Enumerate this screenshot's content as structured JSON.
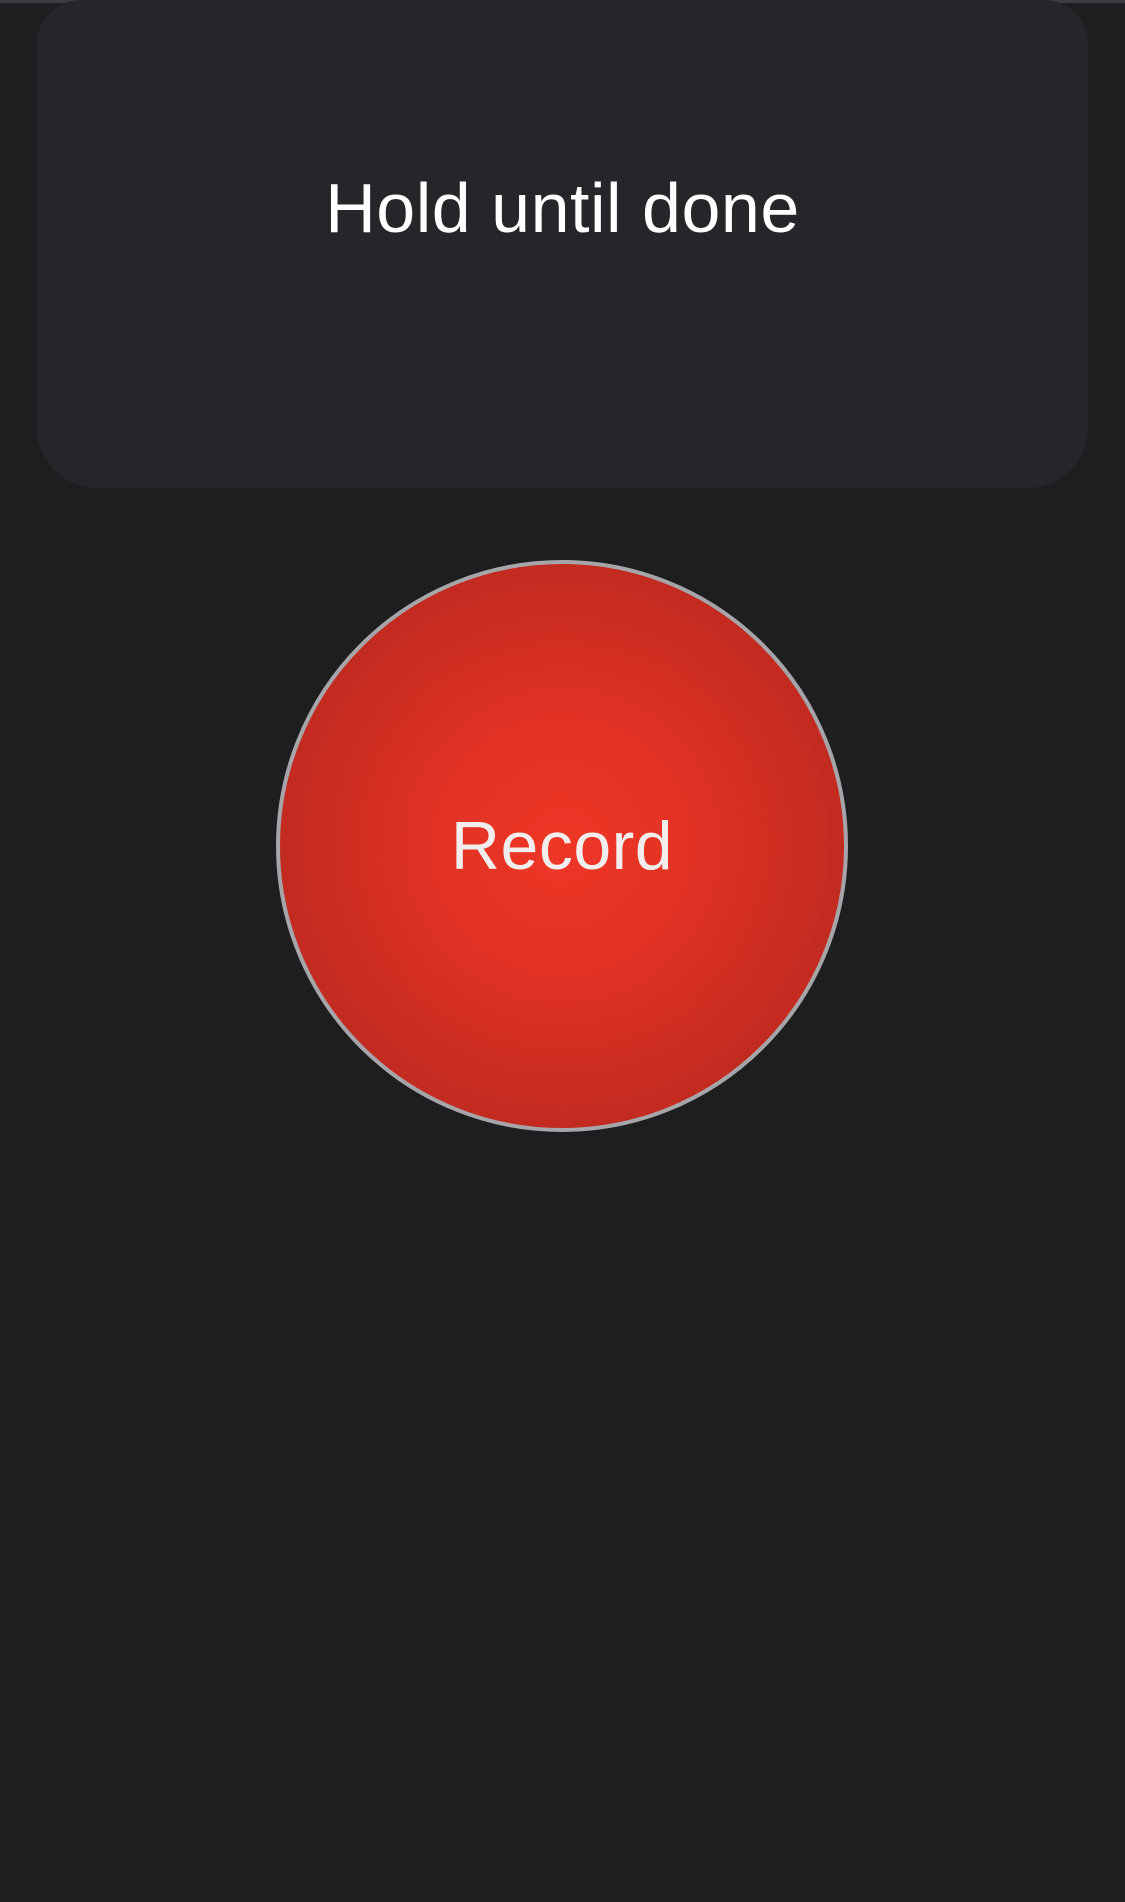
{
  "instruction": {
    "text": "Hold until done"
  },
  "record_button": {
    "label": "Record"
  },
  "colors": {
    "background": "#1d1e20",
    "card": "#24262a",
    "record_red": "#e33324",
    "record_border": "#a6a6aa"
  }
}
